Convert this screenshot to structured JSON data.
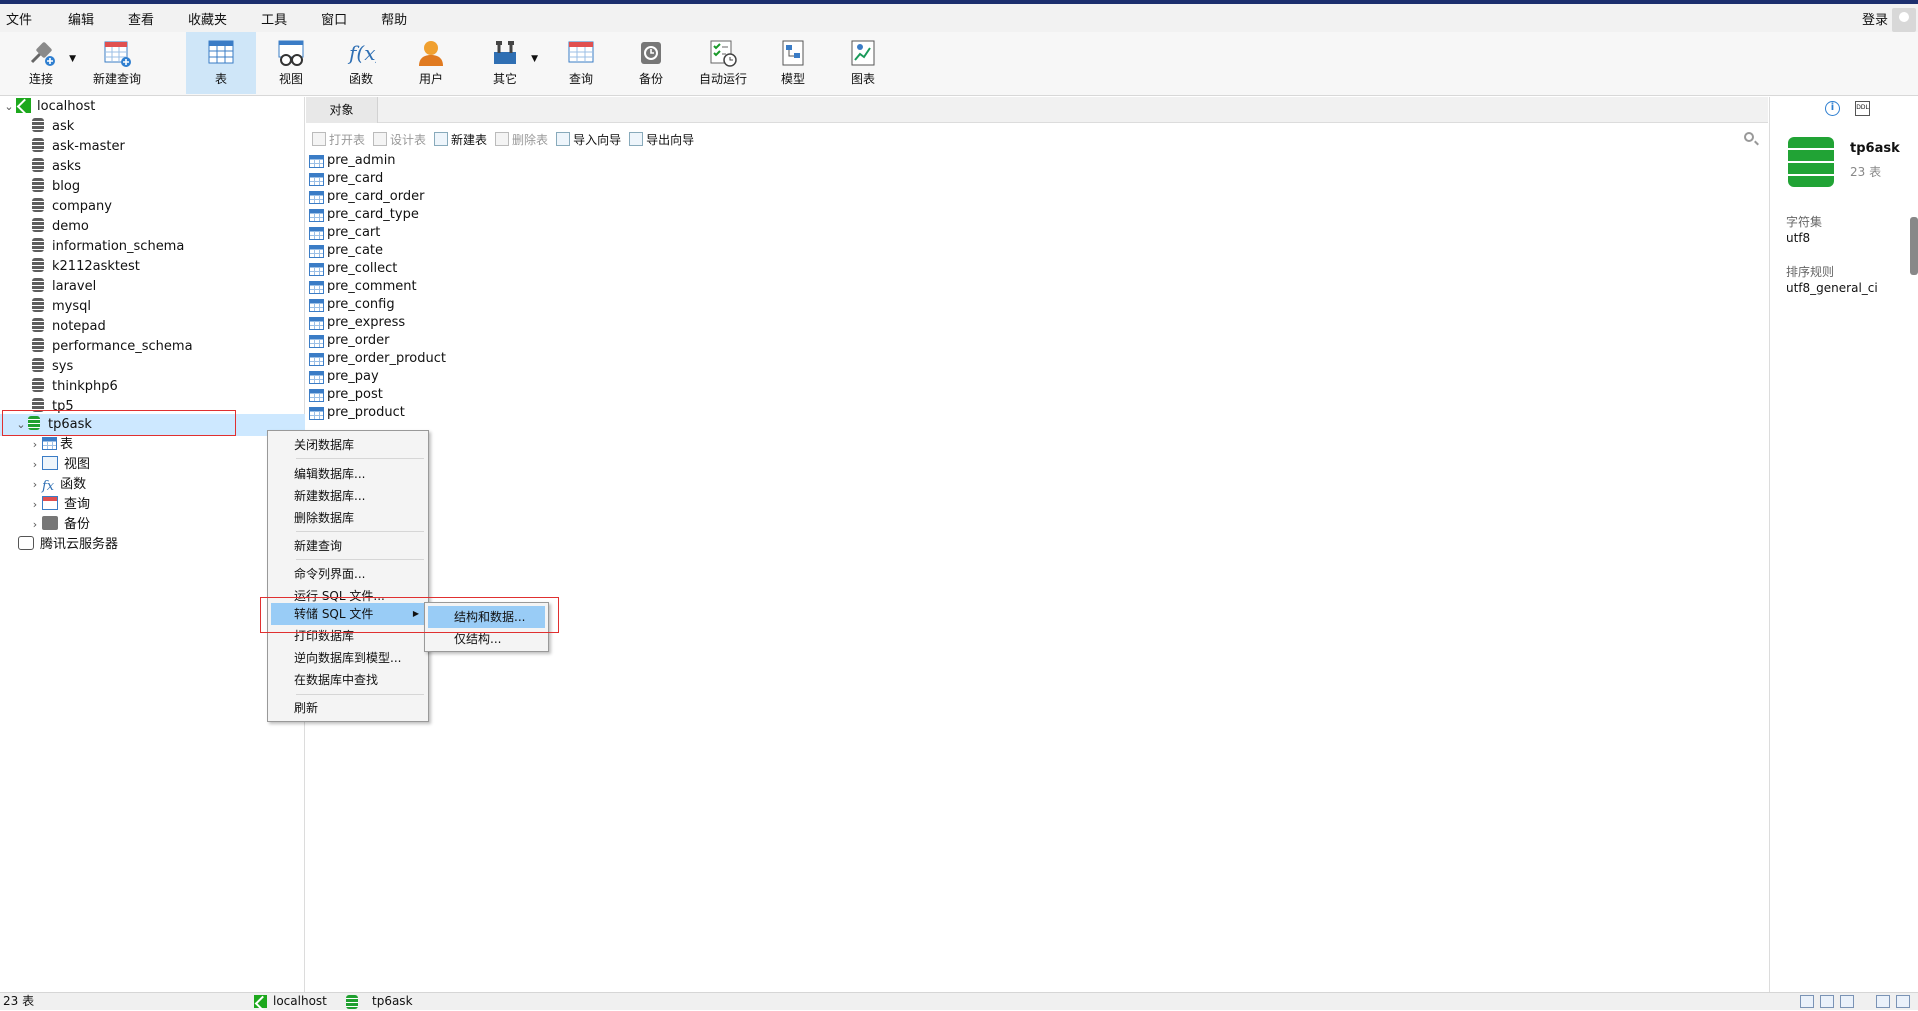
{
  "menubar": {
    "items": [
      "文件",
      "编辑",
      "查看",
      "收藏夹",
      "工具",
      "窗口",
      "帮助"
    ],
    "login": "登录"
  },
  "toolbar": {
    "items": [
      {
        "label": "连接",
        "icon": "plug-icon"
      },
      {
        "label": "新建查询",
        "icon": "new-query-icon"
      },
      {
        "label": "表",
        "icon": "table-icon"
      },
      {
        "label": "视图",
        "icon": "view-icon"
      },
      {
        "label": "函数",
        "icon": "function-icon"
      },
      {
        "label": "用户",
        "icon": "user-icon"
      },
      {
        "label": "其它",
        "icon": "tools-icon"
      },
      {
        "label": "查询",
        "icon": "query-icon"
      },
      {
        "label": "备份",
        "icon": "backup-icon"
      },
      {
        "label": "自动运行",
        "icon": "schedule-icon"
      },
      {
        "label": "模型",
        "icon": "model-icon"
      },
      {
        "label": "图表",
        "icon": "chart-icon"
      }
    ]
  },
  "tree": {
    "host": "localhost",
    "databases": [
      "ask",
      "ask-master",
      "asks",
      "blog",
      "company",
      "demo",
      "information_schema",
      "k2112asktest",
      "laravel",
      "mysql",
      "notepad",
      "performance_schema",
      "sys",
      "thinkphp6",
      "tp5"
    ],
    "open_db": "tp6ask",
    "children": [
      "表",
      "视图",
      "函数",
      "查询",
      "备份"
    ],
    "cloud": "腾讯云服务器"
  },
  "objects": {
    "tab": "对象",
    "toolbar": [
      "打开表",
      "设计表",
      "新建表",
      "删除表",
      "导入向导",
      "导出向导"
    ],
    "tables": [
      "pre_admin",
      "pre_card",
      "pre_card_order",
      "pre_card_type",
      "pre_cart",
      "pre_cate",
      "pre_collect",
      "pre_comment",
      "pre_config",
      "pre_express",
      "pre_order",
      "pre_order_product",
      "pre_pay",
      "pre_post",
      "pre_product"
    ]
  },
  "context_menu": {
    "items": [
      "关闭数据库",
      "编辑数据库...",
      "新建数据库...",
      "删除数据库",
      "新建查询",
      "命令列界面...",
      "运行 SQL 文件...",
      "转储 SQL 文件",
      "打印数据库",
      "逆向数据库到模型...",
      "在数据库中查找",
      "刷新"
    ],
    "highlighted": "转储 SQL 文件",
    "submenu": [
      "结构和数据...",
      "仅结构..."
    ]
  },
  "info": {
    "name": "tp6ask",
    "count": "23 表",
    "charset_label": "字符集",
    "charset": "utf8",
    "collation_label": "排序规则",
    "collation": "utf8_general_ci",
    "ddl": "DDL"
  },
  "status": {
    "count": "23 表",
    "host": "localhost",
    "db": "tp6ask"
  },
  "colors": {
    "accent": "#cfe6f8",
    "highlight": "#99ccf6",
    "db_green": "#21a335",
    "red_box": "#e03030"
  }
}
